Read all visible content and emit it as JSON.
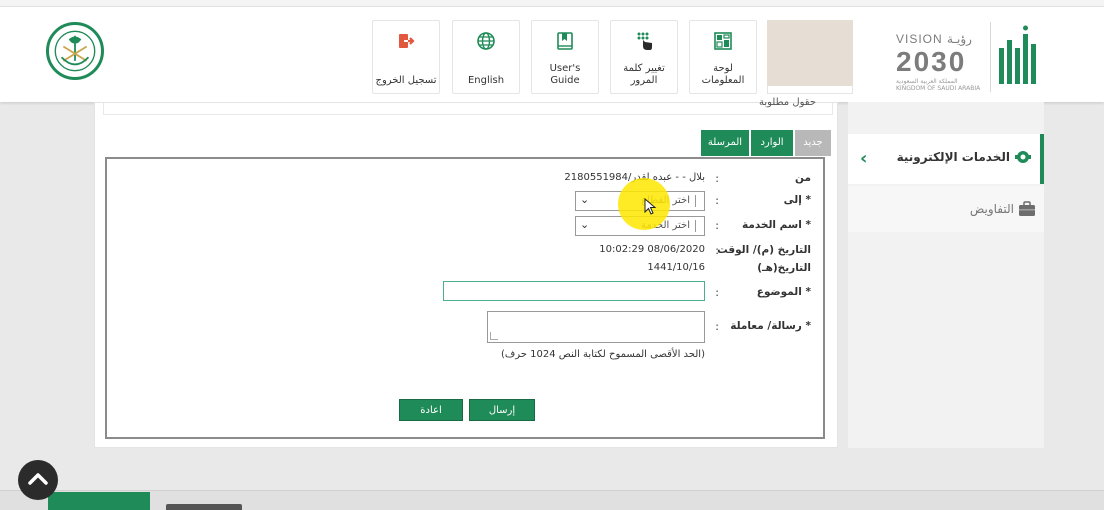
{
  "header": {
    "tiles": [
      {
        "label": "تسجيل الخروج",
        "icon": "logout-icon",
        "color": "#e2583e"
      },
      {
        "label": "English",
        "icon": "globe-icon",
        "color": "#1f8b58"
      },
      {
        "label": "User's Guide",
        "icon": "book-icon",
        "color": "#1f8b58"
      },
      {
        "label": "تغيير كلمة\nالمرور",
        "icon": "keypad-icon",
        "color": "#1f8b58"
      },
      {
        "label": "لوحة\nالمعلومات",
        "icon": "dashboard-icon",
        "color": "#1f8b58"
      }
    ],
    "vision": {
      "line1": "VISION",
      "line1_ar": "رؤيـة",
      "year": "2030",
      "kingdom_ar": "المملكة العربية السعودية",
      "kingdom_en": "KINGDOM OF SAUDI ARABIA"
    },
    "accent": "#1f8b58"
  },
  "sidebar": {
    "items": [
      {
        "label": "الخدمات الإلكترونية",
        "icon": "eservices-icon",
        "active": true
      },
      {
        "label": "التفاويض",
        "icon": "briefcase-icon",
        "active": false
      }
    ]
  },
  "main": {
    "cut_text": "حقول مطلوبة",
    "tabs": [
      {
        "label": "جديد",
        "color": "#b8b8b8"
      },
      {
        "label": "الوارد",
        "color": "#1f8b58"
      },
      {
        "label": "المرسلة",
        "color": "#1f8b58"
      }
    ],
    "form": {
      "from": {
        "label": "من",
        "value": "2180551984/بلال - - عبده لقدر"
      },
      "to": {
        "label": "إلى",
        "required": "*",
        "selected": "اختر القطاع"
      },
      "service": {
        "label": "اسم الخدمة",
        "required": "*",
        "selected": "اختر الخدمة"
      },
      "datetime": {
        "label": "التاريخ (م)/ الوقت",
        "value": "10:02:29 08/06/2020"
      },
      "hijri": {
        "label": "التاريخ(هـ)",
        "value": "1441/10/16"
      },
      "subject": {
        "label": "الموضوع",
        "required": "*",
        "value": ""
      },
      "message": {
        "label": "رسالة/ معاملة",
        "required": "*",
        "value": ""
      },
      "hint": "(الحد الأقصى المسموح لكتابة النص 1024 حرف)",
      "colon": ":"
    },
    "buttons": {
      "send": "إرسال",
      "reset": "اعادة"
    }
  }
}
